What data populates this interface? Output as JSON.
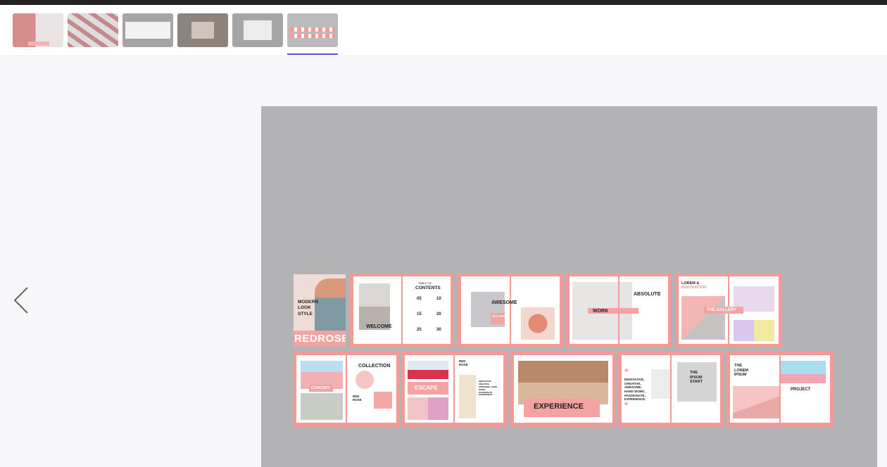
{
  "thumbnails": [
    {
      "id": "thumb-1",
      "color": "#c98b8a"
    },
    {
      "id": "thumb-2",
      "color": "#b49a9a"
    },
    {
      "id": "thumb-3",
      "color": "#a9a9ab"
    },
    {
      "id": "thumb-4",
      "color": "#8d857e"
    },
    {
      "id": "thumb-5",
      "color": "#a4a2a4"
    },
    {
      "id": "thumb-6",
      "color": "#b9b8bb"
    }
  ],
  "active_thumbnail": 6,
  "accent_color": "#5b4fc6",
  "preview": {
    "cover": {
      "tagline": "MODERN LOOK STYLE",
      "brand": "REDROSE"
    },
    "welcome": "WELCOME",
    "toc": {
      "title_small": "TABLE OF",
      "title": "CONTENTS",
      "nums": [
        "05",
        "10",
        "15",
        "20",
        "25",
        "30"
      ]
    },
    "awesome": "AWESOME",
    "text_here": "TEXT HERE",
    "work": "WORK",
    "absolute": "ABSOLUTE",
    "lorem_inspiration": {
      "line1": "LOREM &",
      "line2": "INSPIRATION"
    },
    "the_gallery": "THE GALLERY",
    "concept": "CONCEPT",
    "collection": "COLLECTION",
    "red_rose": "RED ROSE",
    "escape": "ESCAPE",
    "innovative_small": "INNOVATIVE, CREATIVE, AWESOME, HARD WORK, PASSIONATE, EXPERIENCE.",
    "experience": "EXPERIENCE",
    "quote_text": "INNOVATIVE, CREATIVE, AWESOME, HARD WORK, PASSIONATE, EXPERIENCE.",
    "the_ipsum_start": "THE IPSUM START",
    "the_lorem_ipsum": "THE LOREM IPSUM",
    "project": "PROJECT"
  }
}
